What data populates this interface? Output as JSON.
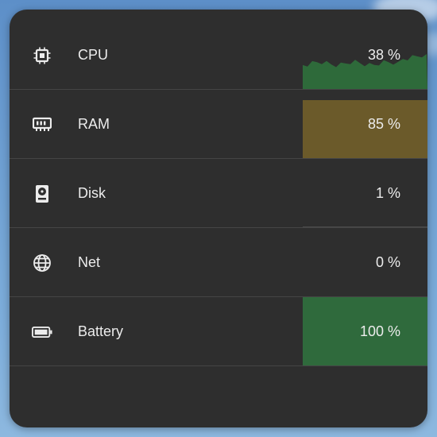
{
  "colors": {
    "panel": "#2e2e2e",
    "divider": "#454545",
    "text": "#ececec",
    "cpu_meter": "#2e6a3a",
    "ram_meter": "#6b5a2a",
    "disk_meter": "#4a4a4a",
    "battery_meter": "#2f6a3c"
  },
  "monitor": {
    "rows": [
      {
        "name": "cpu",
        "label": "CPU",
        "value": "38 %",
        "percent": 38,
        "icon": "chip-icon"
      },
      {
        "name": "ram",
        "label": "RAM",
        "value": "85 %",
        "percent": 85,
        "icon": "memory-icon"
      },
      {
        "name": "disk",
        "label": "Disk",
        "value": "1 %",
        "percent": 1,
        "icon": "hard-drive-icon"
      },
      {
        "name": "net",
        "label": "Net",
        "value": "0 %",
        "percent": 0,
        "icon": "globe-icon"
      },
      {
        "name": "battery",
        "label": "Battery",
        "value": "100 %",
        "percent": 100,
        "icon": "battery-icon"
      }
    ]
  }
}
